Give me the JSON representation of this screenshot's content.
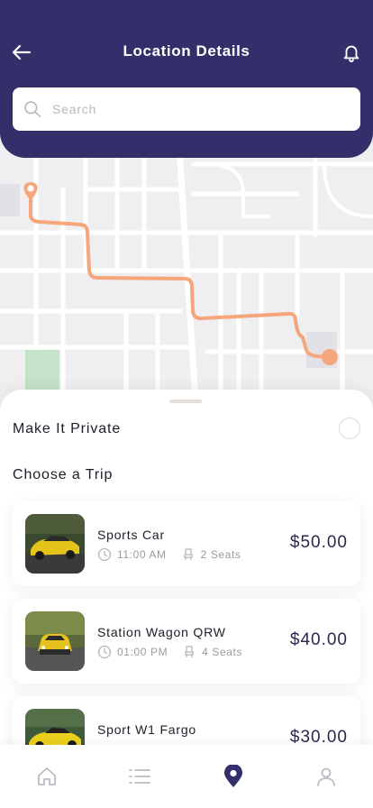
{
  "header": {
    "title": "Location Details",
    "back_icon": "arrow-left-icon",
    "notification_icon": "bell-icon",
    "background_color": "#332f6b"
  },
  "search": {
    "placeholder": "Search",
    "value": ""
  },
  "map": {
    "route_color": "#f5a67a",
    "park_color": "#c5e3c8"
  },
  "sheet": {
    "private_label": "Make It Private",
    "private_enabled": false,
    "choose_label": "Choose a Trip"
  },
  "trips": [
    {
      "name": "Sports Car",
      "time": "11:00 AM",
      "seats": "2 Seats",
      "price": "$50.00"
    },
    {
      "name": "Station Wagon QRW",
      "time": "01:00 PM",
      "seats": "4 Seats",
      "price": "$40.00"
    },
    {
      "name": "Sport W1 Fargo",
      "time": "",
      "seats": "",
      "price": "$30.00"
    }
  ],
  "bottom_nav": {
    "items": [
      {
        "icon": "home-icon",
        "active": false
      },
      {
        "icon": "list-icon",
        "active": false
      },
      {
        "icon": "location-pin-icon",
        "active": true
      },
      {
        "icon": "profile-icon",
        "active": false
      }
    ],
    "active_color": "#332f6b",
    "inactive_color": "#bcbcc4"
  }
}
